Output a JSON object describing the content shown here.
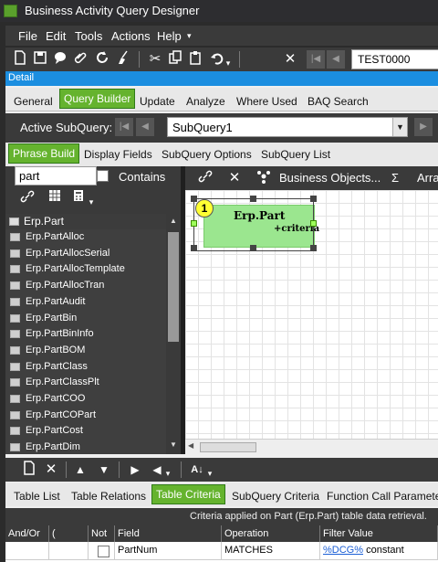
{
  "window": {
    "title": "Business Activity Query Designer"
  },
  "menu": [
    "File",
    "Edit",
    "Tools",
    "Actions",
    "Help"
  ],
  "toolbar": {
    "key_value": "TEST0000"
  },
  "detail_label": "Detail",
  "main_tabs": [
    {
      "label": "General",
      "active": false
    },
    {
      "label": "Query Builder",
      "active": true
    },
    {
      "label": "Update",
      "active": false
    },
    {
      "label": "Analyze",
      "active": false
    },
    {
      "label": "Where Used",
      "active": false
    },
    {
      "label": "BAQ Search",
      "active": false
    }
  ],
  "subquery": {
    "label": "Active SubQuery:",
    "value": "SubQuery1"
  },
  "sub_tabs": [
    {
      "label": "Phrase Build",
      "active": true
    },
    {
      "label": "Display Fields",
      "active": false
    },
    {
      "label": "SubQuery Options",
      "active": false
    },
    {
      "label": "SubQuery List",
      "active": false
    }
  ],
  "search": {
    "value": "part",
    "contains_label": "Contains"
  },
  "tree_header": "Erp.Part",
  "table_list": [
    "Erp.PartAlloc",
    "Erp.PartAllocSerial",
    "Erp.PartAllocTemplate",
    "Erp.PartAllocTran",
    "Erp.PartAudit",
    "Erp.PartBin",
    "Erp.PartBinInfo",
    "Erp.PartBOM",
    "Erp.PartClass",
    "Erp.PartClassPlt",
    "Erp.PartCOO",
    "Erp.PartCOPart",
    "Erp.PartCost",
    "Erp.PartDim"
  ],
  "canvas_toolbar": {
    "business_objects": "Business Objects...",
    "sigma": "Σ",
    "arrange": "Arra"
  },
  "diagram_node": {
    "name": "Erp.Part",
    "criteria": "+criteria",
    "badge": "1"
  },
  "bottom_tabs": [
    {
      "label": "Table List",
      "active": false
    },
    {
      "label": "Table Relations",
      "active": false
    },
    {
      "label": "Table Criteria",
      "active": true
    },
    {
      "label": "SubQuery Criteria",
      "active": false
    },
    {
      "label": "Function Call Parameter",
      "active": false
    }
  ],
  "criteria_info": "Criteria applied on Part (Erp.Part)  table data retrieval.",
  "criteria_grid": {
    "columns": [
      "And/Or",
      "(",
      "Not",
      "Field",
      "Operation",
      "Filter Value"
    ],
    "row": {
      "field": "PartNum",
      "operation": "MATCHES",
      "filter_link": "%DCG%",
      "filter_suffix": "constant"
    }
  }
}
